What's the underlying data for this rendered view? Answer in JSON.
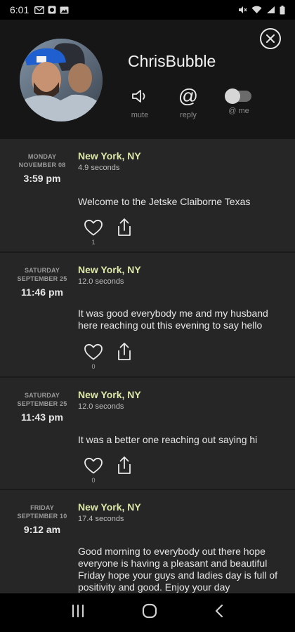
{
  "status_bar": {
    "time": "6:01"
  },
  "profile": {
    "username": "ChrisBubble",
    "actions": [
      {
        "label": "mute",
        "icon": "speaker-icon"
      },
      {
        "label": "reply",
        "icon": "at-icon",
        "glyph": "@"
      },
      {
        "label": "@ me",
        "icon": "toggle-switch",
        "state": "off"
      }
    ]
  },
  "posts": [
    {
      "day": "MONDAY",
      "date": "NOVEMBER 08",
      "time": "3:59 pm",
      "location": "New York, NY",
      "duration": "4.9 seconds",
      "text": "Welcome to the Jetske Claiborne Texas",
      "likes": "1"
    },
    {
      "day": "SATURDAY",
      "date": "SEPTEMBER 25",
      "time": "11:46 pm",
      "location": "New York, NY",
      "duration": "12.0 seconds",
      "text": "It was good everybody me and my husband here reaching out this evening to say hello",
      "likes": "0"
    },
    {
      "day": "SATURDAY",
      "date": "SEPTEMBER 25",
      "time": "11:43 pm",
      "location": "New York, NY",
      "duration": "12.0 seconds",
      "text": "It was a better one reaching out saying hi",
      "likes": "0"
    },
    {
      "day": "FRIDAY",
      "date": "SEPTEMBER 10",
      "time": "9:12 am",
      "location": "New York, NY",
      "duration": "17.4 seconds",
      "text": "Good morning to everybody out there hope everyone is having a pleasant and beautiful Friday hope your guys and ladies day is full of positivity and good. Enjoy your day",
      "likes": ""
    }
  ],
  "colors": {
    "location": "#dde8a8",
    "feed_bg": "#262626",
    "header_bg": "#161616"
  }
}
